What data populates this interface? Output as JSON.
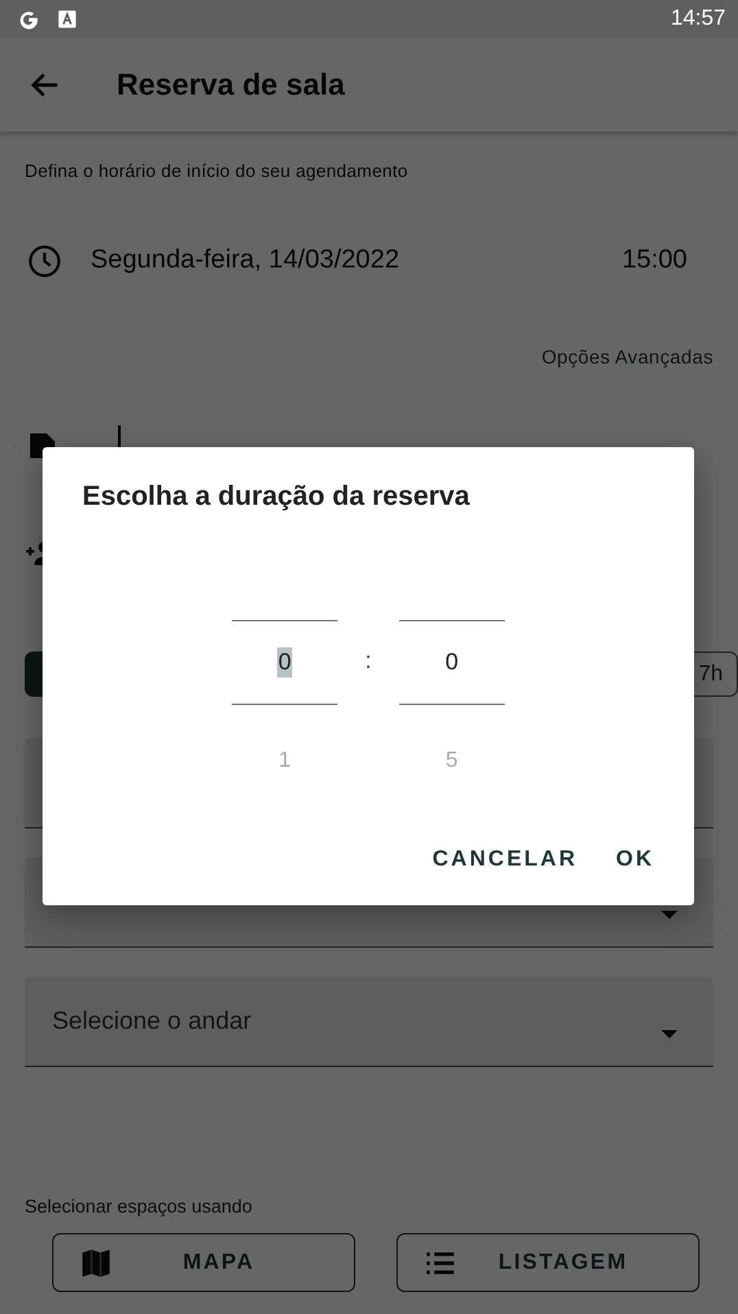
{
  "status_bar": {
    "time": "14:57"
  },
  "app_bar": {
    "title": "Reserva de sala"
  },
  "start_hint": "Defina o horário de início do seu agendamento",
  "start": {
    "date": "Segunda-feira, 14/03/2022",
    "time": "15:00"
  },
  "advanced_link": "Opções Avançadas",
  "duration_chips": [
    {
      "selected": true
    },
    {
      "label": "7h",
      "selected": false
    }
  ],
  "selects": [
    {
      "kind": "covered"
    },
    {
      "kind": "dropdown"
    },
    {
      "kind": "dropdown",
      "placeholder": "Selecione o andar"
    }
  ],
  "spaces": {
    "label": "Selecionar espaços usando",
    "buttons": [
      {
        "label": "MAPA",
        "kind": "map"
      },
      {
        "label": "LISTAGEM",
        "kind": "list"
      }
    ]
  },
  "dialog": {
    "title": "Escolha a duração da reserva",
    "columns": [
      {
        "value": "0",
        "next": "1",
        "selected": true
      },
      {
        "value": "0",
        "next": "5",
        "selected": false
      }
    ],
    "separator": ":",
    "actions": [
      "CANCELAR",
      "OK"
    ]
  }
}
